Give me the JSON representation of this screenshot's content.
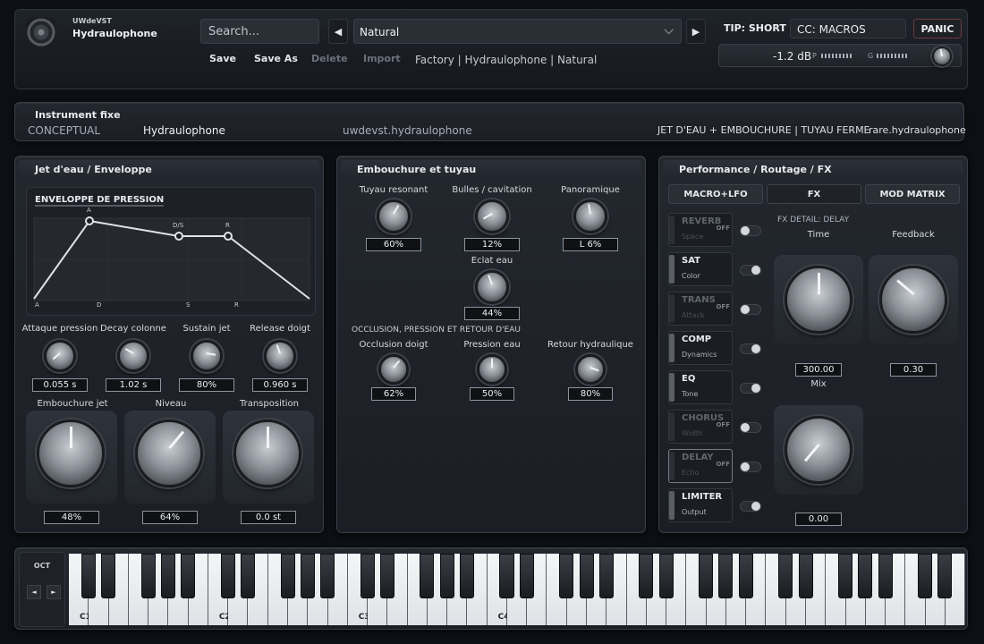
{
  "header": {
    "brand_small": "UWdeVST",
    "brand_name": "Hydraulophone",
    "search_placeholder": "Search...",
    "prev_icon": "◀",
    "next_icon": "▶",
    "preset": "Natural",
    "buttons": {
      "save": "Save",
      "save_as": "Save As",
      "delete": "Delete",
      "import": "Import"
    },
    "breadcrumb": "Factory | Hydraulophone | Natural",
    "tip": "TIP: SHORT",
    "cc": "CC: MACROS",
    "panic": "PANIC",
    "db": "-1.2 dB",
    "meter_p": "P",
    "meter_g": "G"
  },
  "instrument": {
    "title": "Instrument fixe",
    "type": "CONCEPTUAL",
    "name": "Hydraulophone",
    "id": "uwdevst.hydraulophone",
    "tags": "JET D'EAU + EMBOUCHURE | TUYAU FERME",
    "bundle": "rare.hydraulophone"
  },
  "left": {
    "title": "Jet d'eau / Enveloppe",
    "env_title": "ENVELOPPE DE PRESSION",
    "env_points": {
      "a": "A",
      "ds": "D/S",
      "r": "R"
    },
    "env_axis": {
      "a": "A",
      "d": "D",
      "s": "S",
      "r": "R"
    },
    "knobs": [
      {
        "label": "Attaque pression",
        "value": "0.055 s"
      },
      {
        "label": "Decay colonne",
        "value": "1.02 s"
      },
      {
        "label": "Sustain jet",
        "value": "80%"
      },
      {
        "label": "Release doigt",
        "value": "0.960 s"
      }
    ],
    "big_knobs": [
      {
        "label": "Embouchure jet",
        "value": "48%"
      },
      {
        "label": "Niveau",
        "value": "64%"
      },
      {
        "label": "Transposition",
        "value": "0.0 st"
      }
    ]
  },
  "middle": {
    "title": "Embouchure et tuyau",
    "knobs": [
      {
        "label": "Tuyau resonant",
        "value": "60%"
      },
      {
        "label": "Bulles / cavitation",
        "value": "12%"
      },
      {
        "label": "Panoramique",
        "value": "L 6%"
      },
      {
        "label": "Eclat eau",
        "value": "44%"
      }
    ],
    "section2": "OCCLUSION, PRESSION ET RETOUR D'EAU",
    "knobs2": [
      {
        "label": "Occlusion doigt",
        "value": "62%"
      },
      {
        "label": "Pression eau",
        "value": "50%"
      },
      {
        "label": "Retour hydraulique",
        "value": "80%"
      }
    ]
  },
  "right": {
    "title": "Performance / Routage / FX",
    "tabs": [
      "MACRO+LFO",
      "FX",
      "MOD MATRIX"
    ],
    "fx_detail": "FX DETAIL: DELAY",
    "off_tag": "OFF",
    "fx": [
      {
        "name": "REVERB",
        "sub": "Space",
        "on": false
      },
      {
        "name": "SAT",
        "sub": "Color",
        "on": true
      },
      {
        "name": "TRANS",
        "sub": "Attack",
        "on": false
      },
      {
        "name": "COMP",
        "sub": "Dynamics",
        "on": true
      },
      {
        "name": "EQ",
        "sub": "Tone",
        "on": true
      },
      {
        "name": "CHORUS",
        "sub": "Width",
        "on": false
      },
      {
        "name": "DELAY",
        "sub": "Echo",
        "on": false
      },
      {
        "name": "LIMITER",
        "sub": "Output",
        "on": true
      }
    ],
    "params": [
      {
        "label": "Time",
        "value": "300.00"
      },
      {
        "label": "Feedback",
        "value": "0.30"
      },
      {
        "label": "Mix",
        "value": "0.00"
      }
    ]
  },
  "keyboard": {
    "oct_label": "OCT",
    "oct_down": "◄",
    "oct_up": "►",
    "labels": [
      "C1",
      "C2",
      "C3",
      "C4"
    ]
  }
}
